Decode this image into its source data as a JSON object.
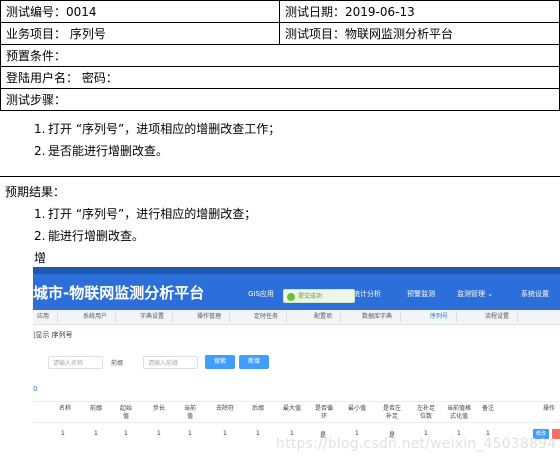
{
  "header": {
    "test_no": "测试编号：0014",
    "test_date": "测试日期：2019-06-13",
    "business": "业务项目：  序列号",
    "test_item": "测试项目：物联网监测分析平台",
    "precondition": "预置条件：",
    "login": "登陆用户名：      密码：",
    "test_steps": "测试步骤："
  },
  "steps": [
    {
      "n": "1.",
      "text": "打开 “序列号”，进项相应的增删改查工作；"
    },
    {
      "n": "2.",
      "text": "是否能进行增删改查。"
    }
  ],
  "expected": {
    "title": "预期结果：",
    "items": [
      {
        "n": "1.",
        "text": "打开 “序列号”，进行相应的增删改查；"
      },
      {
        "n": "2.",
        "text": "能进行增删改查。"
      }
    ],
    "add_label": "增"
  },
  "screenshot": {
    "brand": "城市-物联网监测分析平台",
    "menu": [
      "GIS应用",
      "统计分析",
      "预警监测",
      "监测管理 ⌄",
      "系统设置"
    ],
    "toast": "提交成功",
    "tabs": [
      "应用",
      "系统用户",
      "字典设置",
      "操作管理",
      "定时任务",
      "配置项",
      "数据库字典",
      "序列号",
      "流程设置"
    ],
    "breadcrumb": "|显示 序列号",
    "search_placeholder_1": "请输入名称",
    "search_label_2": "前缀",
    "search_placeholder_2": "请输入前缀",
    "search_button": "搜索",
    "add_button": "新增",
    "subtab": "0",
    "columns": [
      "名称",
      "前缀",
      "起始值",
      "步长",
      "当前值",
      "去除符",
      "后缀",
      "最大值",
      "是否循环",
      "最小值",
      "是否左补足",
      "左补足位数",
      "当前值格式化值",
      "备注",
      "操作"
    ],
    "row": [
      "1",
      "1",
      "1",
      "1",
      "1",
      "1",
      "1",
      "1",
      "是",
      "1",
      "是",
      "1",
      "1",
      "1"
    ],
    "edit_label": "修改",
    "watermark": "https://blog.csdn.net/weixin_45038894"
  }
}
